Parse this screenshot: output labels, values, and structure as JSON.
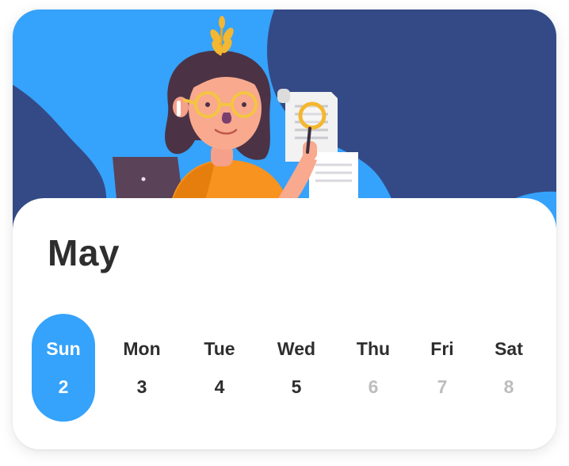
{
  "calendar": {
    "month": "May",
    "days": [
      {
        "name": "Sun",
        "number": "2",
        "selected": true
      },
      {
        "name": "Mon",
        "number": "3"
      },
      {
        "name": "Tue",
        "number": "4"
      },
      {
        "name": "Wed",
        "number": "5"
      },
      {
        "name": "Thu",
        "number": "6",
        "muted": true
      },
      {
        "name": "Fri",
        "number": "7",
        "muted": true
      },
      {
        "name": "Sat",
        "number": "8",
        "muted": true
      }
    ]
  },
  "colors": {
    "accent": "#35a2fb",
    "header_dark": "#344a86",
    "text_dark": "#2e2e2e",
    "text_muted": "#bdbdbd"
  },
  "illustration": {
    "icons": [
      "person-illustration",
      "laptop-icon",
      "document-icon",
      "magnifier-icon",
      "leaf-sprout-icon"
    ]
  }
}
